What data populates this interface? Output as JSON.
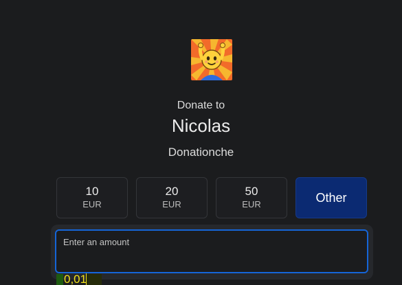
{
  "donation": {
    "intro": "Donate to",
    "recipient": "Nicolas",
    "page_name": "Donationche"
  },
  "amount_options": [
    {
      "value": "10",
      "currency": "EUR"
    },
    {
      "value": "20",
      "currency": "EUR"
    },
    {
      "value": "50",
      "currency": "EUR"
    }
  ],
  "other_option": {
    "label": "Other",
    "selected": true
  },
  "custom_amount": {
    "label": "Enter an amount",
    "value": "0,01"
  },
  "colors": {
    "background": "#1b1c1e",
    "selected_button": "#0b2a72",
    "focus_border": "#1565d8",
    "amount_text": "#f2e21a"
  },
  "icons": {
    "avatar": "smiling-character-raising-hands-avatar"
  }
}
